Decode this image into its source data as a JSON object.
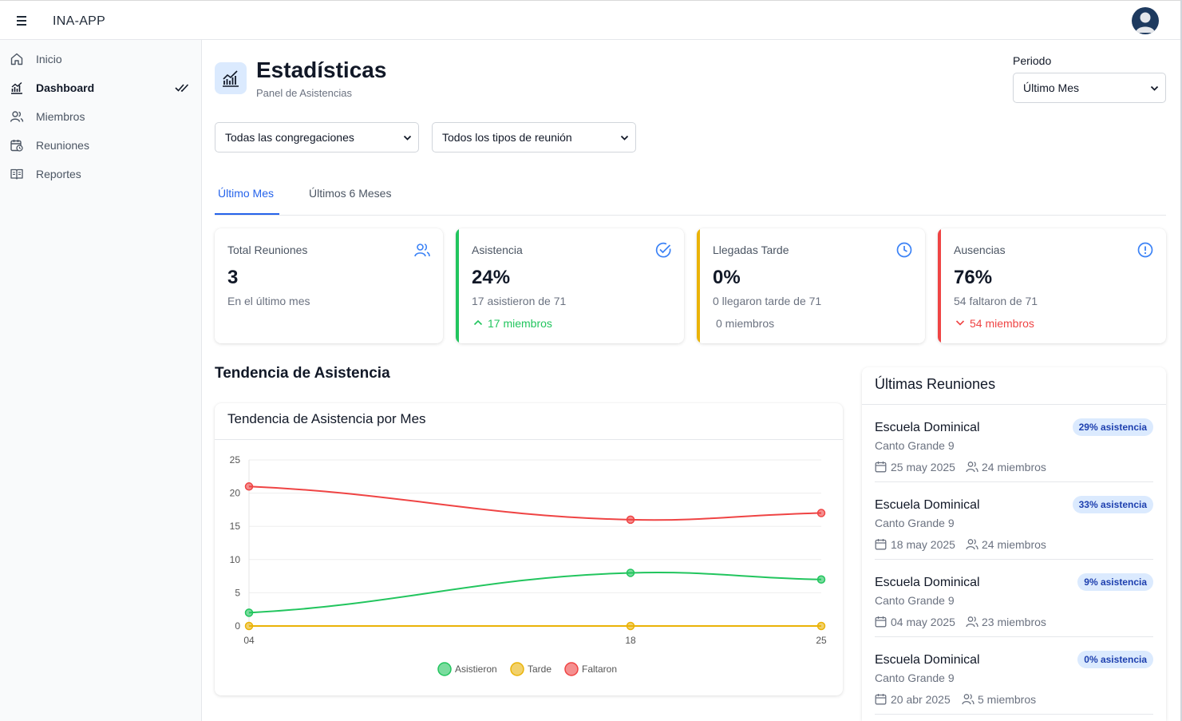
{
  "app": {
    "title": "INA-APP"
  },
  "sidebar": {
    "items": [
      {
        "label": "Inicio",
        "icon": "home-icon"
      },
      {
        "label": "Dashboard",
        "icon": "chart-icon",
        "active": true
      },
      {
        "label": "Miembros",
        "icon": "users-icon"
      },
      {
        "label": "Reuniones",
        "icon": "calendar-clock-icon"
      },
      {
        "label": "Reportes",
        "icon": "book-icon"
      }
    ]
  },
  "header": {
    "title": "Estadísticas",
    "subtitle": "Panel de Asistencias",
    "periodo_label": "Periodo",
    "periodo_value": "Último Mes"
  },
  "filters": {
    "congregacion": "Todas las congregaciones",
    "tipo_reunion": "Todos los tipos de reunión"
  },
  "tabs": [
    {
      "label": "Último Mes",
      "active": true
    },
    {
      "label": "Últimos 6 Meses"
    }
  ],
  "cards": [
    {
      "label": "Total Reuniones",
      "value": "3",
      "sub": "En el último mes",
      "trend": "",
      "color": "#3b82f6",
      "icon": "users-icon"
    },
    {
      "label": "Asistencia",
      "value": "24%",
      "sub": "17 asistieron de 71",
      "trend": "17 miembros",
      "trend_dir": "up",
      "color": "#22c55e",
      "icon": "check-circle-icon"
    },
    {
      "label": "Llegadas Tarde",
      "value": "0%",
      "sub": "0 llegaron tarde de 71",
      "trend": "0 miembros",
      "trend_dir": "none",
      "color": "#eab308",
      "icon": "clock-icon"
    },
    {
      "label": "Ausencias",
      "value": "76%",
      "sub": "54 faltaron de 71",
      "trend": "54 miembros",
      "trend_dir": "down",
      "color": "#ef4444",
      "icon": "alert-circle-icon"
    }
  ],
  "trend_section": {
    "title": "Tendencia de Asistencia"
  },
  "chart_data": {
    "type": "line",
    "title": "Tendencia de Asistencia por Mes",
    "x": [
      "04",
      "18",
      "25"
    ],
    "ylim": [
      0,
      25
    ],
    "yticks": [
      0,
      5,
      10,
      15,
      20,
      25
    ],
    "grid": true,
    "legend": "bottom",
    "series": [
      {
        "name": "Asistieron",
        "values": [
          2,
          8,
          7
        ],
        "color": "#22c55e"
      },
      {
        "name": "Tarde",
        "values": [
          0,
          0,
          0
        ],
        "color": "#eab308"
      },
      {
        "name": "Faltaron",
        "values": [
          21,
          16,
          17
        ],
        "color": "#ef4444"
      }
    ]
  },
  "recent": {
    "title": "Últimas Reuniones",
    "meetings": [
      {
        "title": "Escuela Dominical",
        "place": "Canto Grande 9",
        "date": "25 may 2025",
        "members": "24 miembros",
        "badge": "29% asistencia"
      },
      {
        "title": "Escuela Dominical",
        "place": "Canto Grande 9",
        "date": "18 may 2025",
        "members": "24 miembros",
        "badge": "33% asistencia"
      },
      {
        "title": "Escuela Dominical",
        "place": "Canto Grande 9",
        "date": "04 may 2025",
        "members": "23 miembros",
        "badge": "9% asistencia"
      },
      {
        "title": "Escuela Dominical",
        "place": "Canto Grande 9",
        "date": "20 abr 2025",
        "members": "5 miembros",
        "badge": "0% asistencia"
      }
    ]
  }
}
